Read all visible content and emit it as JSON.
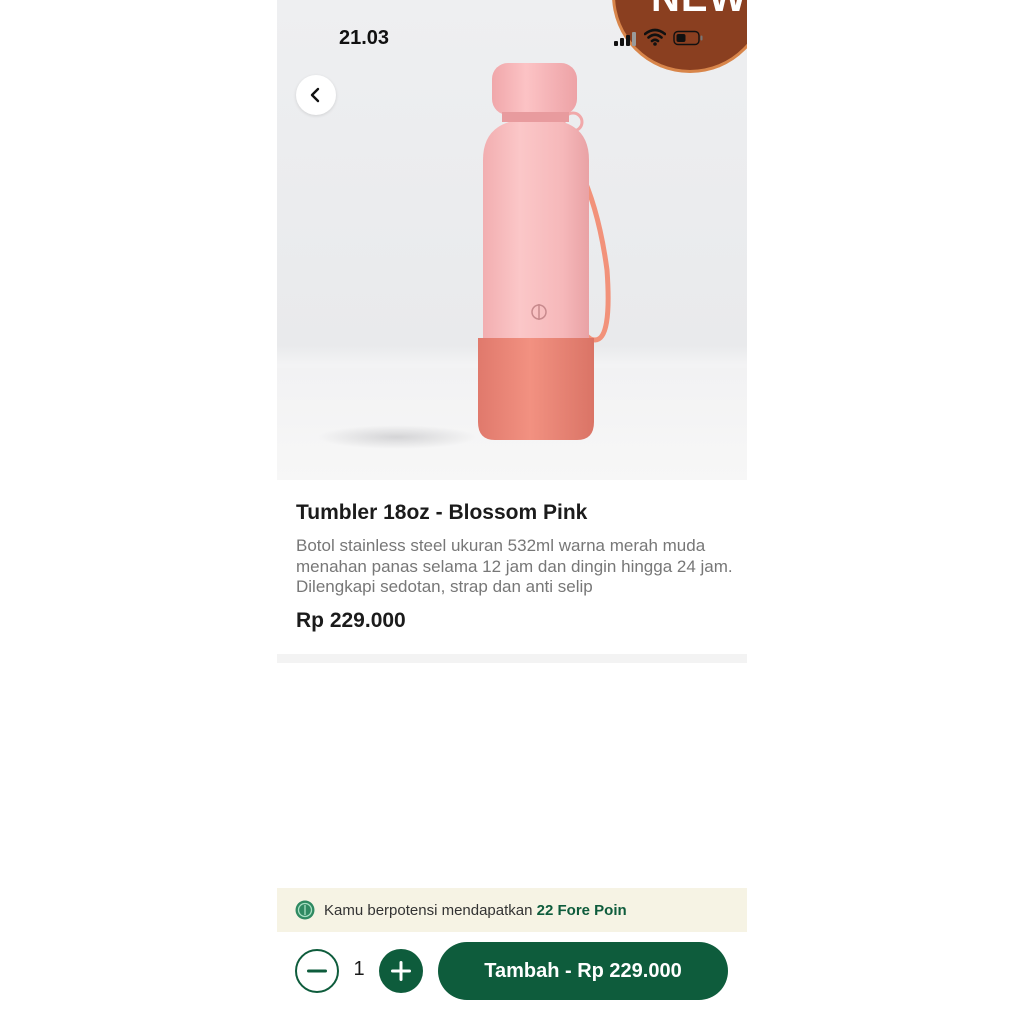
{
  "status_bar": {
    "time": "21.03",
    "signal_icon": "signal-icon",
    "wifi_icon": "wifi-icon",
    "battery_icon": "battery-icon"
  },
  "hero": {
    "badge_text": "NEW",
    "back_icon": "chevron-left-icon"
  },
  "product": {
    "title": "Tumbler 18oz - Blossom Pink",
    "description": "Botol stainless steel ukuran 532ml warna merah muda menahan panas selama 12 jam dan dingin hingga 24 jam. Dilengkapi sedotan, strap dan anti selip",
    "price": "Rp 229.000"
  },
  "points": {
    "prefix": "Kamu berpotensi mendapatkan ",
    "highlight": "22 Fore Poin",
    "icon": "fore-coin-icon"
  },
  "cart": {
    "quantity": "1",
    "add_label": "Tambah - Rp 229.000"
  },
  "colors": {
    "brand_green": "#0e5c3c",
    "banner_bg": "#f6f3e4",
    "badge_brown": "#8a3f20"
  }
}
